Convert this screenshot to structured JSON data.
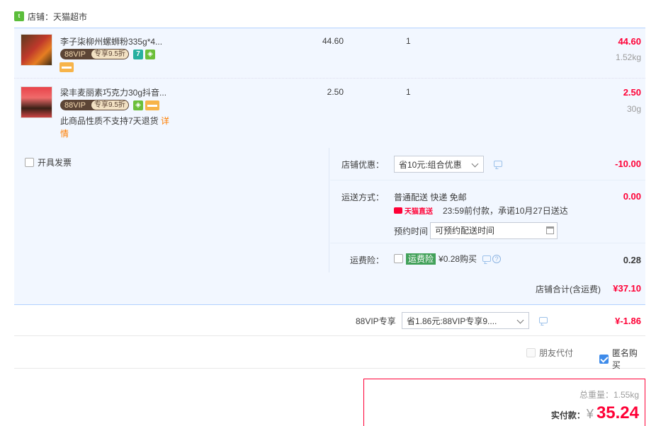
{
  "shop": {
    "label": "店铺：天猫超市",
    "logo": "tmall-logo-icon"
  },
  "items": [
    {
      "name": "李子柒柳州螺蛳粉335g*4...",
      "vip_label": "88VIP",
      "vip_discount": "专享9.5折",
      "tag_seven": "7",
      "price": "44.60",
      "qty": "1",
      "total": "44.60",
      "weight": "1.52kg"
    },
    {
      "name": "梁丰麦丽素巧克力30g抖音...",
      "vip_label": "88VIP",
      "vip_discount": "专享9.5折",
      "price": "2.50",
      "qty": "1",
      "total": "2.50",
      "weight": "30g",
      "no_return_text": "此商品性质不支持7天退货",
      "no_return_link": "详情"
    }
  ],
  "invoice": {
    "label": "开具发票",
    "checked": false
  },
  "shop_discount": {
    "label": "店铺优惠：",
    "selected": "省10元:组合优惠",
    "amount": "-10.00"
  },
  "shipping": {
    "label": "运送方式：",
    "method": "普通配送 快递 免邮",
    "brand": "天猫直送",
    "promise": "23:59前付款，承诺10月27日送达",
    "appoint_label": "预约时间",
    "appoint_placeholder": "可预约配送时间",
    "amount": "0.00"
  },
  "insurance": {
    "label": "运费险：",
    "badge": "运费险",
    "text": "¥0.28购买",
    "amount": "0.28"
  },
  "shop_total": {
    "label": "店铺合计(含运费)",
    "value": "¥37.10"
  },
  "vip": {
    "label": "88VIP专享",
    "selected": "省1.86元:88VIP专享9....",
    "amount": "¥-1.86"
  },
  "options": {
    "friend_pay": "朋友代付",
    "anonymous": "匿名购买",
    "anonymous_checked": true
  },
  "payment": {
    "weight_label": "总重量：1.55kg",
    "pay_label": "实付款：",
    "currency": "¥",
    "amount": "35.24"
  },
  "colors": {
    "accent": "#ff0036",
    "panel": "#f2f7ff",
    "border_blue": "#b2d1ff",
    "tmall_green": "#5bbd3a"
  }
}
